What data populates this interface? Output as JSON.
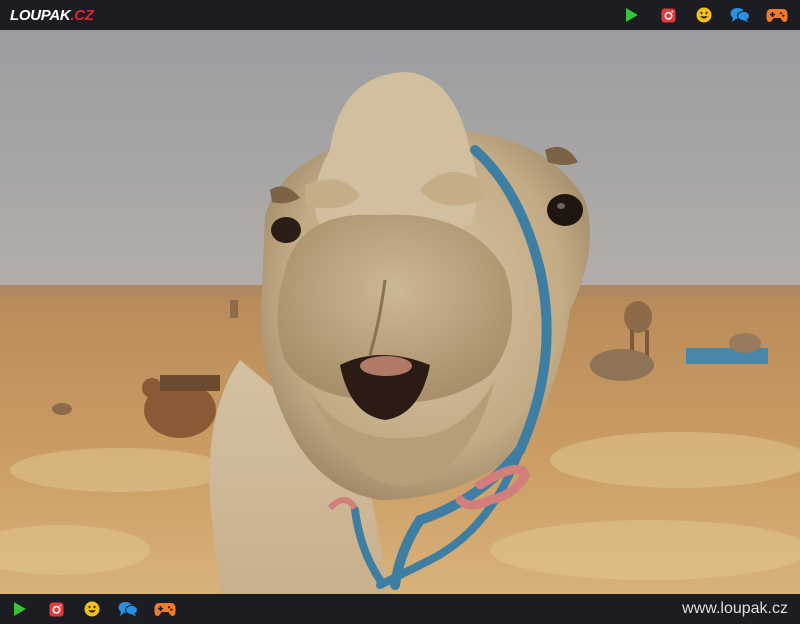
{
  "header": {
    "logo_main": "LOUPAK",
    "logo_tld": ".CZ",
    "icons": [
      "play-icon",
      "instagram-icon",
      "smiley-icon",
      "chat-icon",
      "gamepad-icon"
    ]
  },
  "footer": {
    "icons": [
      "play-icon",
      "instagram-icon",
      "smiley-icon",
      "chat-icon",
      "gamepad-icon"
    ],
    "site_url": "www.loupak.cz"
  },
  "colors": {
    "bar_bg": "#1c1d22",
    "logo_accent": "#e0262a",
    "play": "#38c43a",
    "instagram": "#e03a3a",
    "smiley": "#f2c21b",
    "chat": "#2b8fe0",
    "gamepad": "#f07a2a"
  },
  "photo": {
    "subject": "camel-face-closeup"
  }
}
